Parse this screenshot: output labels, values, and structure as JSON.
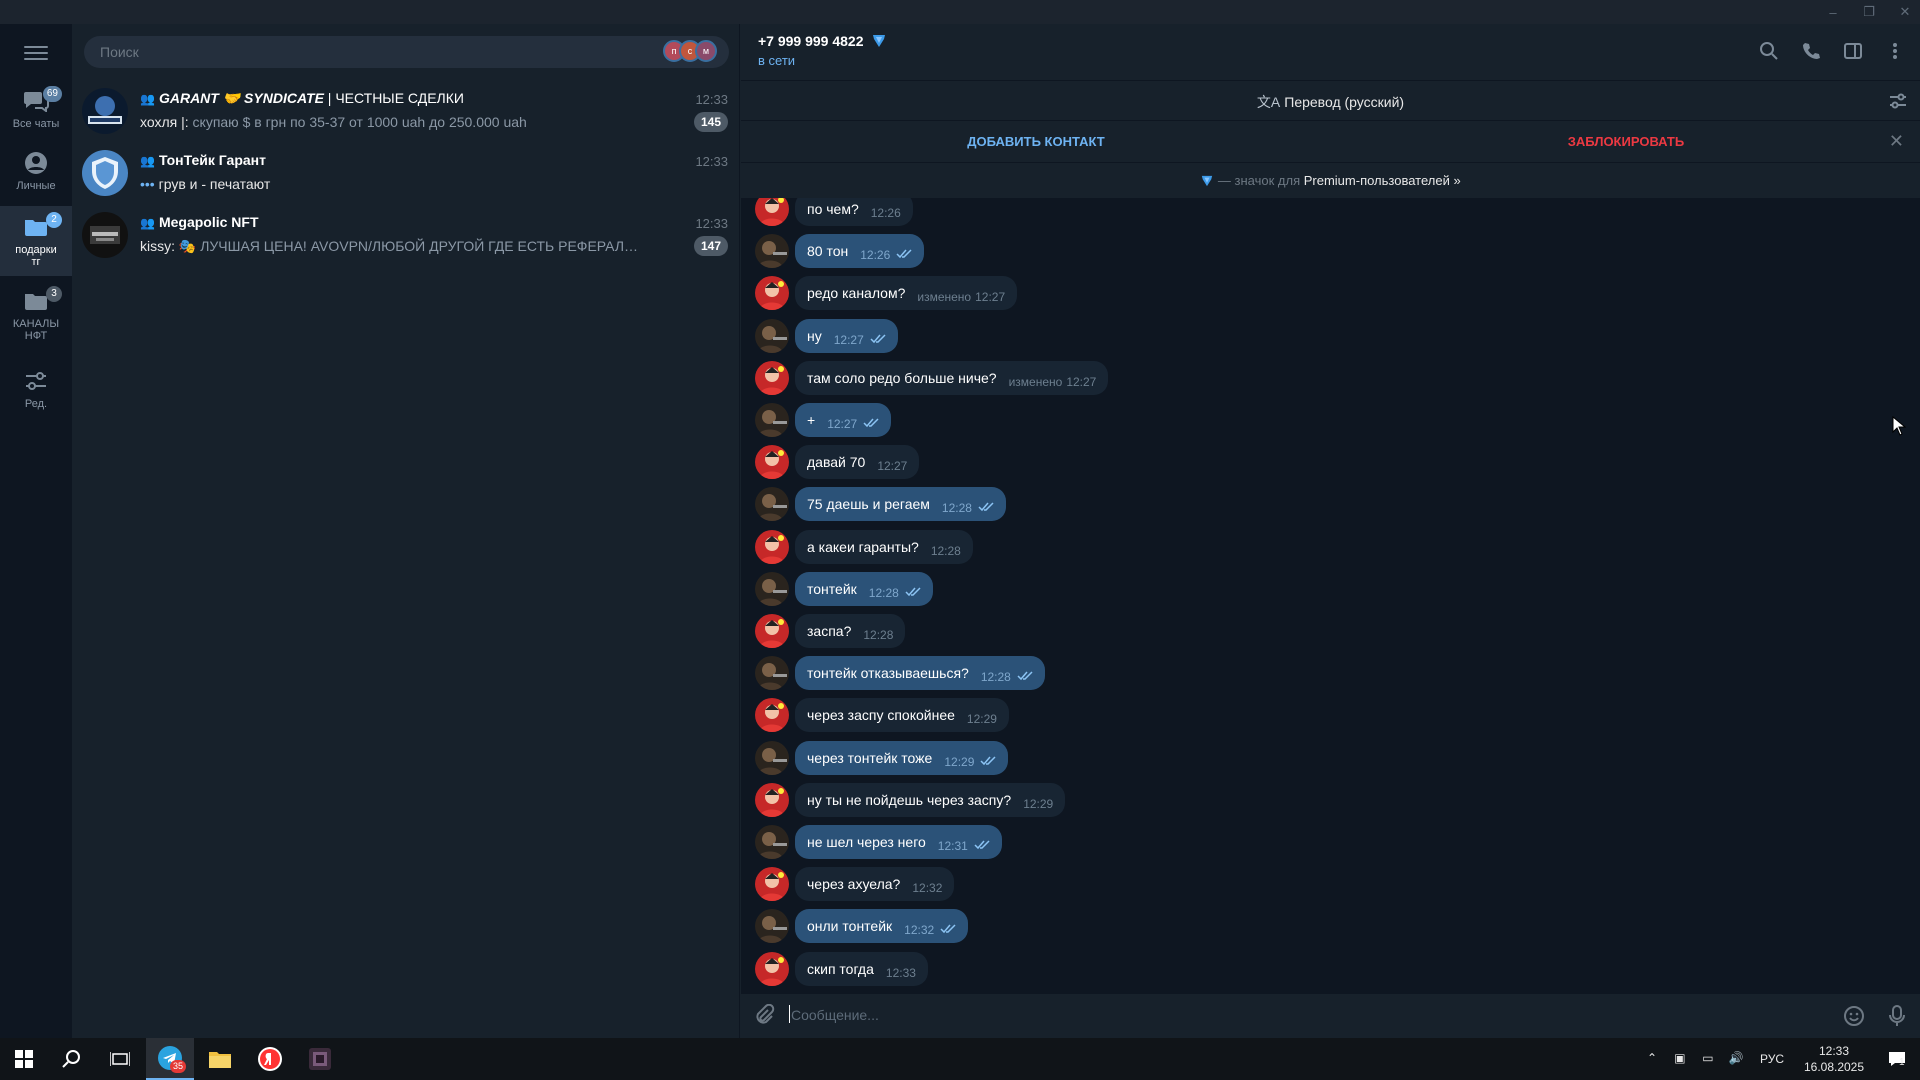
{
  "window": {
    "controls": [
      "–",
      "❐",
      "✕"
    ]
  },
  "rail": {
    "folders": [
      {
        "label": "Все чаты",
        "badge": "69"
      },
      {
        "label": "Личные",
        "badge": ""
      },
      {
        "label": "подарки тг",
        "badge": "2"
      },
      {
        "label": "КАНАЛЫ НФТ",
        "badge": "3"
      },
      {
        "label": "Ред.",
        "badge": ""
      }
    ]
  },
  "search": {
    "placeholder": "Поиск",
    "story_initials": [
      "п",
      "с",
      "м"
    ]
  },
  "chats": [
    {
      "title_bold": "GARANT 🤝 SYNDICATE",
      "title_rest": " | ЧЕСТНЫЕ СДЕЛКИ",
      "time": "12:33",
      "sender": "хохля |:",
      "preview": " скупаю $ в грн по 35-37 от 1000 uah до 250.000 uah",
      "unread": "145"
    },
    {
      "title_bold": "ТонТейк Гарант",
      "title_rest": "",
      "time": "12:33",
      "sender": "•••",
      "preview": " грув и - печатают",
      "unread": ""
    },
    {
      "title_bold": "Megapolic NFT",
      "title_rest": "",
      "time": "12:33",
      "sender": "kissy:",
      "preview": " 🎭 ЛУЧШАЯ ЦЕНА! AVOVPN/ЛЮБОЙ ДРУГОЙ ГДЕ ЕСТЬ РЕФЕРАЛЬНАЯ ССЫЛКА(к...",
      "unread": "147"
    }
  ],
  "header": {
    "name": "+7 999 999 4822",
    "status": "в сети"
  },
  "translate_bar": {
    "label": "Перевод (русский)"
  },
  "action_bar": {
    "add_contact": "ДОБАВИТЬ КОНТАКТ",
    "block": "ЗАБЛОКИРОВАТЬ",
    "close": "✕"
  },
  "premium_bar": {
    "prefix": " — значок для ",
    "link": "Premium-пользователей »"
  },
  "messages": [
    {
      "dir": "in",
      "text": "по чем?",
      "time": "12:26",
      "edited": ""
    },
    {
      "dir": "out",
      "text": "80 тон",
      "time": "12:26",
      "edited": ""
    },
    {
      "dir": "in",
      "text": "редо каналом?",
      "time": "12:27",
      "edited": "изменено"
    },
    {
      "dir": "out",
      "text": "ну",
      "time": "12:27",
      "edited": ""
    },
    {
      "dir": "in",
      "text": "там соло редо больше ниче?",
      "time": "12:27",
      "edited": "изменено"
    },
    {
      "dir": "out",
      "text": "+",
      "time": "12:27",
      "edited": ""
    },
    {
      "dir": "in",
      "text": "давай 70",
      "time": "12:27",
      "edited": ""
    },
    {
      "dir": "out",
      "text": "75 даешь и регаем",
      "time": "12:28",
      "edited": ""
    },
    {
      "dir": "in",
      "text": "а какеи гаранты?",
      "time": "12:28",
      "edited": ""
    },
    {
      "dir": "out",
      "text": "тонтейк",
      "time": "12:28",
      "edited": ""
    },
    {
      "dir": "in",
      "text": "заспа?",
      "time": "12:28",
      "edited": ""
    },
    {
      "dir": "out",
      "text": "тонтейк отказываешься?",
      "time": "12:28",
      "edited": ""
    },
    {
      "dir": "in",
      "text": "через заспу спокойнее",
      "time": "12:29",
      "edited": ""
    },
    {
      "dir": "out",
      "text": "через тонтейк тоже",
      "time": "12:29",
      "edited": ""
    },
    {
      "dir": "in",
      "text": "ну ты не пойдешь через заспу?",
      "time": "12:29",
      "edited": ""
    },
    {
      "dir": "out",
      "text": "не шел через него",
      "time": "12:31",
      "edited": ""
    },
    {
      "dir": "in",
      "text": "через ахуела?",
      "time": "12:32",
      "edited": ""
    },
    {
      "dir": "out",
      "text": "онли тонтейк",
      "time": "12:32",
      "edited": ""
    },
    {
      "dir": "in",
      "text": "скип тогда",
      "time": "12:33",
      "edited": ""
    }
  ],
  "composer": {
    "placeholder": "Сообщение..."
  },
  "taskbar": {
    "telegram_badge": "35",
    "lang": "РУС",
    "time": "12:33",
    "date": "16.08.2025",
    "notifications": "1"
  },
  "colors": {
    "accent": "#6eb3f2",
    "danger": "#ec3942",
    "bubble_in": "#182533",
    "bubble_out": "#2b5278",
    "premium": "#3d9be9"
  }
}
